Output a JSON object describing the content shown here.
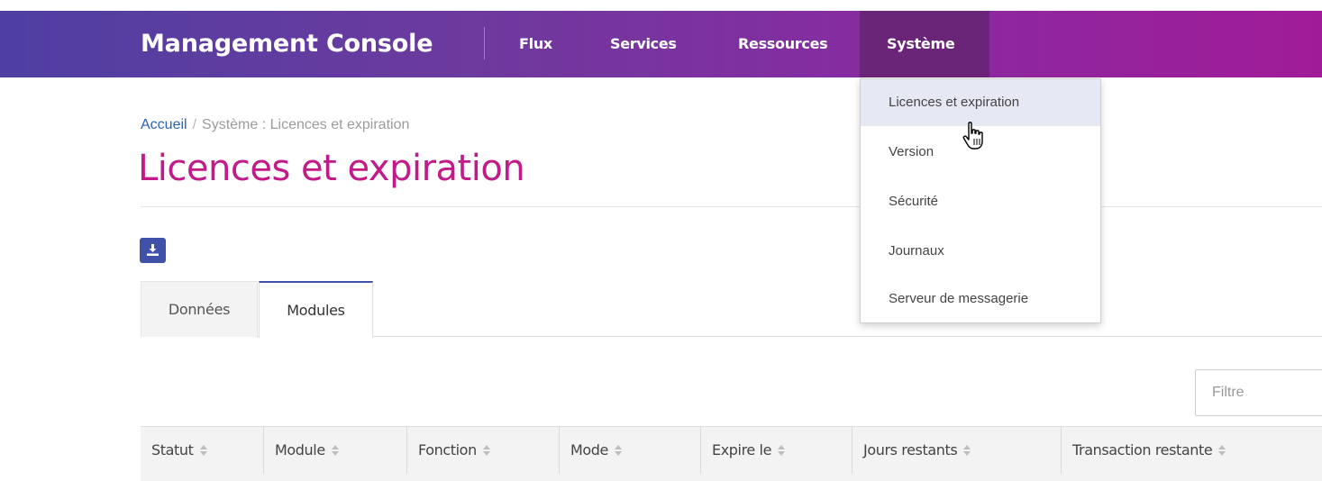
{
  "header": {
    "brand": "Management Console",
    "nav": [
      "Flux",
      "Services",
      "Ressources",
      "Système"
    ]
  },
  "dropdown": {
    "items": [
      "Licences et expiration",
      "Version",
      "Sécurité",
      "Journaux",
      "Serveur de messagerie"
    ],
    "active_index": 0
  },
  "breadcrumb": {
    "home": "Accueil",
    "separator": "/",
    "current": "Système : Licences et expiration"
  },
  "page": {
    "title": "Licences et expiration"
  },
  "toolbar": {
    "download_icon": "download-icon"
  },
  "tabs": [
    "Données",
    "Modules"
  ],
  "active_tab": "Modules",
  "filter": {
    "placeholder": "Filtre"
  },
  "table": {
    "columns": [
      "Statut",
      "Module",
      "Fonction",
      "Mode",
      "Expire le",
      "Jours restants",
      "Transaction restante"
    ]
  },
  "colors": {
    "accent": "#3f51a8",
    "title": "#c21a88",
    "link": "#2b62b8",
    "nav_active": "#6a2478"
  }
}
